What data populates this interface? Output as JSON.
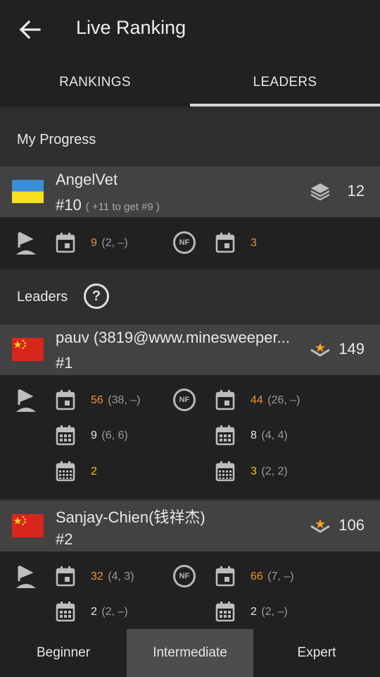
{
  "app": {
    "title": "Live Ranking"
  },
  "tabs": [
    {
      "label": "RANKINGS"
    },
    {
      "label": "LEADERS"
    }
  ],
  "my_progress": {
    "heading": "My Progress",
    "player": {
      "name": "AngelVet",
      "rank": "#10",
      "hint": "( +11 to get #9 )",
      "score": "12",
      "score_icon": "layers-icon",
      "flag": "ukraine-flag"
    },
    "stats": {
      "flags_value": "9",
      "flags_sub": "(2, –)",
      "nf_value": "3"
    }
  },
  "leaders": {
    "heading": "Leaders",
    "help_label": "?",
    "players": [
      {
        "name": "pauv (3819@www.minesweeper...",
        "rank": "#1",
        "score": "149",
        "score_icon": "star-chevron-icon",
        "flag": "china-flag",
        "rows": [
          {
            "left_value": "56",
            "left_sub": "(38, –)",
            "right_value": "44",
            "right_sub": "(26, –)"
          },
          {
            "left_value": "9",
            "left_sub": "(6, 6)",
            "right_value": "8",
            "right_sub": "(4, 4)"
          },
          {
            "left_value": "2",
            "left_sub": "",
            "right_value": "3",
            "right_sub": "(2, 2)"
          }
        ]
      },
      {
        "name": "Sanjay-Chien(钱祥杰)",
        "rank": "#2",
        "score": "106",
        "score_icon": "star-chevron-icon",
        "flag": "china-flag",
        "rows": [
          {
            "left_value": "32",
            "left_sub": "(4, 3)",
            "right_value": "66",
            "right_sub": "(7, –)"
          },
          {
            "left_value": "2",
            "left_sub": "(2, –)",
            "right_value": "2",
            "right_sub": "(2, –)"
          }
        ]
      }
    ]
  },
  "bottom_tabs": [
    {
      "label": "Beginner"
    },
    {
      "label": "Intermediate"
    },
    {
      "label": "Expert"
    }
  ],
  "colors": {
    "accent_orange": "#f0913a",
    "accent_yellow": "#f5c518",
    "background": "#212121",
    "card": "#424242"
  }
}
